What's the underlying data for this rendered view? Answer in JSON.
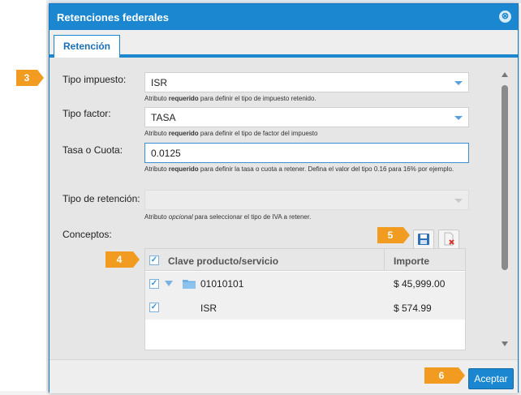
{
  "dialog": {
    "title": "Retenciones federales",
    "close_glyph": "⊗"
  },
  "tabs": [
    {
      "label": "Retención",
      "active": true
    }
  ],
  "form": {
    "tipo_impuesto": {
      "label": "Tipo impuesto:",
      "value": "ISR",
      "help_pre": "Atributo ",
      "help_bold": "requerido",
      "help_post": " para definir el tipo de impuesto retenido."
    },
    "tipo_factor": {
      "label": "Tipo factor:",
      "value": "TASA",
      "help_pre": "Atributo ",
      "help_bold": "requerido",
      "help_post": " para definir el tipo de factor del impuesto"
    },
    "tasa_cuota": {
      "label": "Tasa o Cuota:",
      "value": "0.0125",
      "help_pre": "Atributo ",
      "help_bold": "requerido",
      "help_post": " para definir la tasa o cuota a retener. Defina el valor del tipo 0.16 para 16% por ejemplo."
    },
    "tipo_retencion": {
      "label": "Tipo de retención:",
      "value": "",
      "help_pre": "Atributo ",
      "help_italic": "opcional",
      "help_post": " para seleccionar el tipo de IVA a retener."
    },
    "conceptos_label": "Conceptos:"
  },
  "grid": {
    "columns": [
      "Clave producto/servicio",
      "Importe"
    ],
    "rows": [
      {
        "clave": "01010101",
        "importe": "$ 45,999.00",
        "checked": true,
        "type": "folder"
      },
      {
        "clave": "ISR",
        "importe": "$ 574.99",
        "checked": true,
        "type": "child"
      }
    ]
  },
  "footer": {
    "accept_label": "Aceptar"
  },
  "callouts": [
    "3",
    "4",
    "5",
    "6"
  ],
  "icons": {
    "save": "save-icon",
    "delete": "delete-icon",
    "folder": "folder-icon"
  },
  "colors": {
    "accent": "#1a87d0",
    "callout": "#f29b21"
  }
}
